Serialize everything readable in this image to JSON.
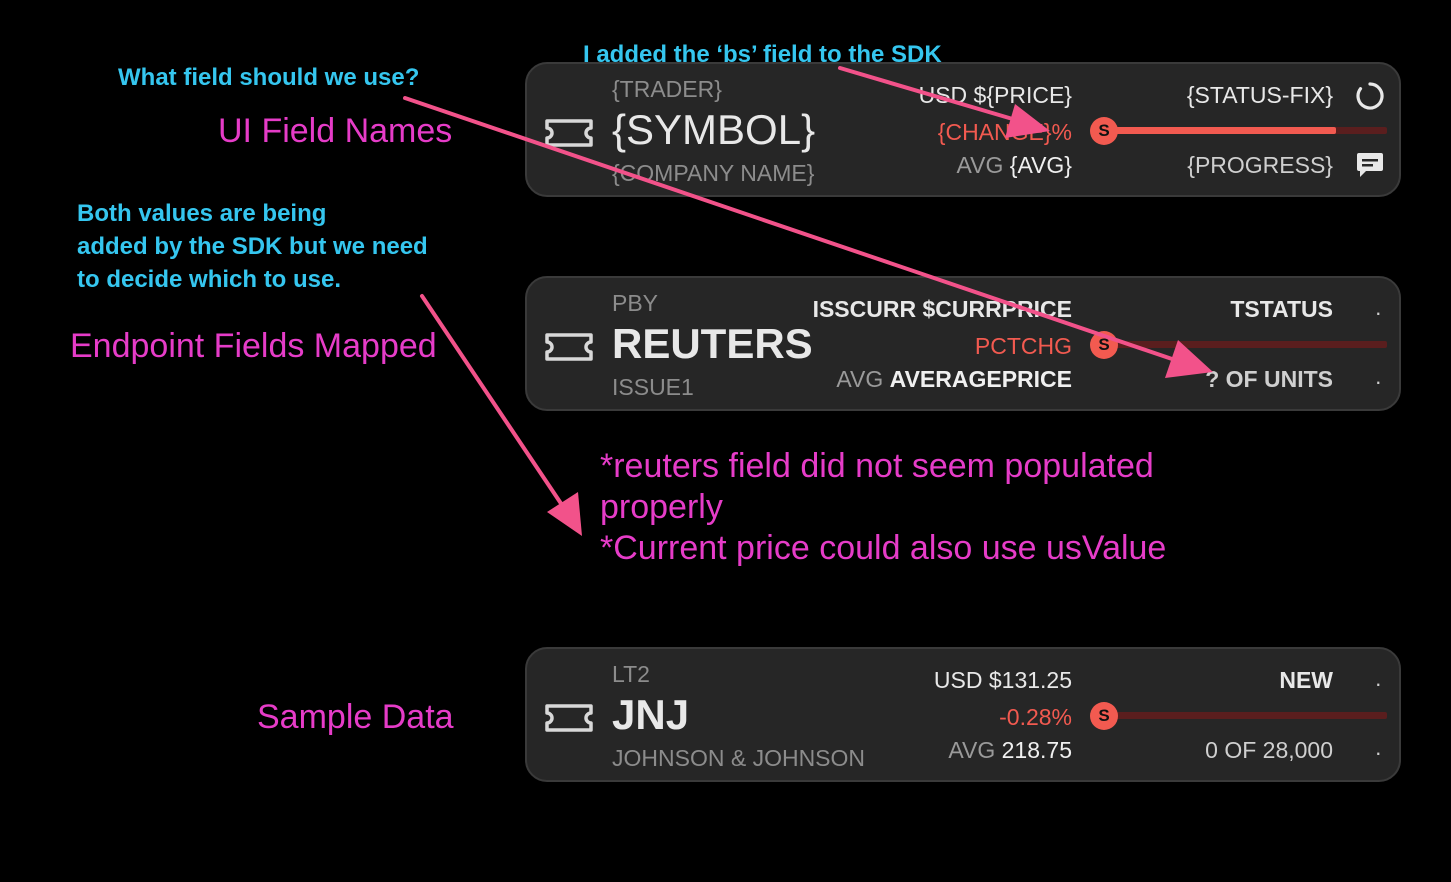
{
  "annotations": {
    "section_ui_field_names": "UI Field Names",
    "section_endpoint_fields": "Endpoint Fields Mapped",
    "section_sample_data": "Sample Data",
    "note_bs_field": "I added the ‘bs’ field to the SDK",
    "note_what_field": "What field should we use?",
    "note_both_values_line1": "Both values are being",
    "note_both_values_line2": "added by the SDK but we need",
    "note_both_values_line3": "to decide which to use.",
    "note_reuters_line1": "*reuters field did not seem populated",
    "note_reuters_line2": "properly",
    "note_current_price": "*Current price could also use usValue"
  },
  "cards": [
    {
      "trader": "{TRADER}",
      "symbol": "{SYMBOL}",
      "company": "{COMPANY NAME}",
      "price": "USD ${PRICE}",
      "change": "{CHANGE}%",
      "avg_label": "AVG",
      "avg_value": "{AVG}",
      "status": "{STATUS-FIX}",
      "progress": "{PROGRESS}",
      "badge": "S",
      "progress_fraction": 0.82,
      "status_icon": "spinner-icon",
      "progress_icon": "comment-icon"
    },
    {
      "trader": "PBY",
      "symbol": "REUTERS",
      "company": "ISSUE1",
      "price": "ISSCURR $CURRPRICE",
      "change": "PCTCHG",
      "avg_label": "AVG",
      "avg_value": "AVERAGEPRICE",
      "status": "TSTATUS",
      "progress": "? OF UNITS",
      "badge": "S",
      "progress_fraction": 0.0,
      "status_icon": "dot",
      "progress_icon": "dot"
    },
    {
      "trader": "LT2",
      "symbol": "JNJ",
      "company": "JOHNSON & JOHNSON",
      "price": "USD $131.25",
      "change": "-0.28%",
      "avg_label": "AVG",
      "avg_value": "218.75",
      "status": "NEW",
      "progress": "0 OF 28,000",
      "badge": "S",
      "progress_fraction": 0.0,
      "status_icon": "dot",
      "progress_icon": "dot"
    }
  ],
  "colors": {
    "accent_red": "#f25a50",
    "track_red": "#5a1e1e",
    "arrow_pink": "#f2528a",
    "label_magenta": "#e63cc8",
    "note_cyan": "#35c6ef",
    "card_bg": "#262626"
  }
}
